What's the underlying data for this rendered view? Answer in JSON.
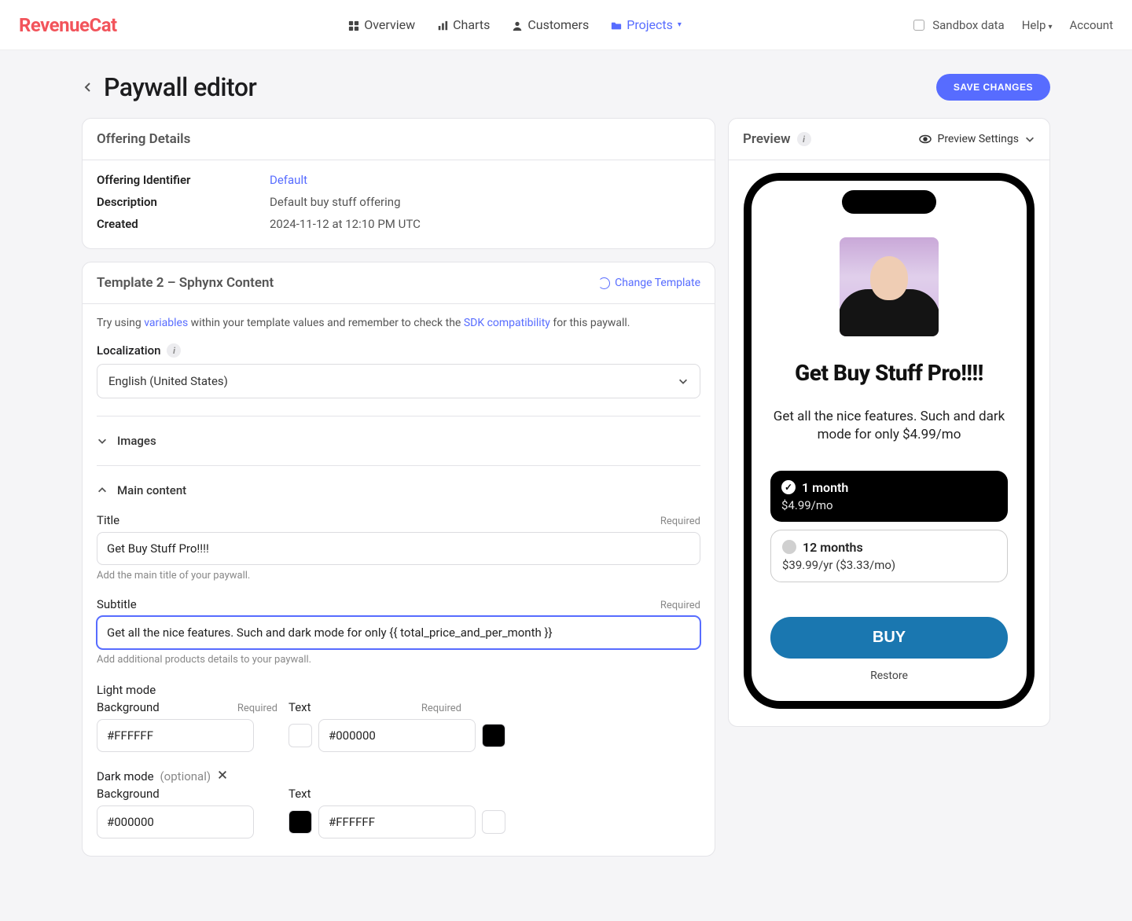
{
  "brand": "RevenueCat",
  "nav": {
    "overview": "Overview",
    "charts": "Charts",
    "customers": "Customers",
    "projects": "Projects",
    "sandbox": "Sandbox data",
    "help": "Help",
    "account": "Account"
  },
  "page": {
    "title": "Paywall editor",
    "save_btn": "SAVE CHANGES"
  },
  "offering": {
    "section_title": "Offering Details",
    "identifier_label": "Offering Identifier",
    "identifier_value": "Default",
    "description_label": "Description",
    "description_value": "Default buy stuff offering",
    "created_label": "Created",
    "created_value": "2024-11-12 at 12:10 PM UTC"
  },
  "template": {
    "section_title": "Template 2 – Sphynx Content",
    "change_label": "Change Template",
    "hint_prefix": "Try using ",
    "hint_link1": "variables",
    "hint_mid": " within your template values and remember to check the ",
    "hint_link2": "SDK compatibility",
    "hint_suffix": " for this paywall.",
    "localization_label": "Localization",
    "localization_value": "English (United States)",
    "images_label": "Images",
    "main_content_label": "Main content",
    "title_label": "Title",
    "title_value": "Get Buy Stuff Pro!!!!",
    "title_help": "Add the main title of your paywall.",
    "subtitle_label": "Subtitle",
    "subtitle_value": "Get all the nice features. Such and dark mode for only {{ total_price_and_per_month }}",
    "subtitle_help": "Add additional products details to your paywall.",
    "required": "Required",
    "lightmode_label": "Light mode",
    "darkmode_label": "Dark mode",
    "optional": "(optional)",
    "background_label": "Background",
    "text_label": "Text",
    "colors": {
      "light_bg": "#FFFFFF",
      "light_text": "#000000",
      "dark_bg": "#000000",
      "dark_text": "#FFFFFF"
    }
  },
  "preview": {
    "section_title": "Preview",
    "settings_label": "Preview Settings",
    "paywall_title": "Get Buy Stuff Pro!!!!",
    "paywall_subtitle": "Get all the nice features. Such and dark mode for only $4.99/mo",
    "plan1_name": "1 month",
    "plan1_price": "$4.99/mo",
    "plan2_name": "12 months",
    "plan2_price": "$39.99/yr ($3.33/mo)",
    "buy": "BUY",
    "restore": "Restore"
  }
}
